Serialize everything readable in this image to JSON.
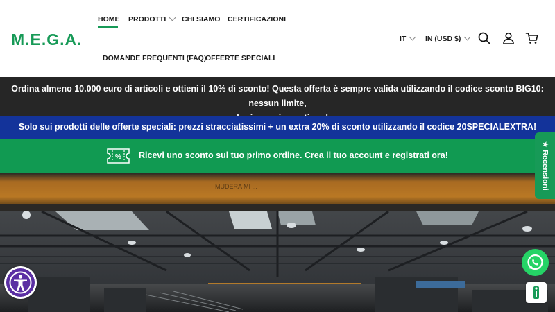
{
  "brand": {
    "logo_text": "M.E.G.A.",
    "color": "#179a57"
  },
  "nav": {
    "home": "HOME",
    "prodotti": "PRODOTTI",
    "chi_siamo": "CHI SIAMO",
    "certificazioni": "CERTIFICAZIONI",
    "faq": "DOMANDE FREQUENTI (FAQ)",
    "offerte": "OFFERTE SPECIALI"
  },
  "locale": {
    "language": "IT",
    "currency": "IN (USD $)"
  },
  "header_icons": [
    "search-icon",
    "account-icon",
    "cart-icon"
  ],
  "banners": {
    "dark_line1": "Ordina almeno 10.000 euro di articoli e ottieni il 10% di sconto! Questa offerta è sempre valida utilizzando il codice sconto BIG10: nessun limite,",
    "dark_line2": "solo risparmio continuo!",
    "blue": "Solo sui prodotti delle offerte speciali: prezzi stracciatissimi + un extra 20% di sconto utilizzando il codice 20SPECIALEXTRA!",
    "green": "Ricevi uno sconto sul tuo primo ordine. Crea il tuo account e registrati ora!",
    "colors": {
      "dark": "#262626",
      "blue": "#13339a",
      "green": "#119a52"
    }
  },
  "hero": {
    "crane_text": "MUDERA  MI ...",
    "image_icon": "factory-interior-image"
  },
  "floating": {
    "reviews_label": "★ Recensioni",
    "whatsapp_icon": "whatsapp-icon",
    "help_icon": "info-icon",
    "accessibility_icon": "accessibility-icon"
  }
}
